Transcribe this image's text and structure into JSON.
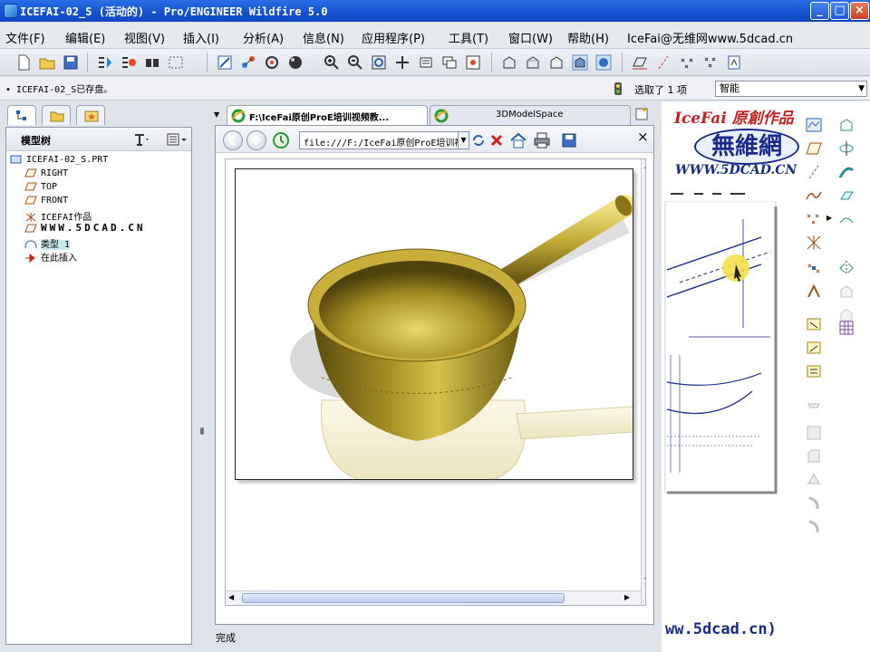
{
  "window": {
    "title": "ICEFAI-02_S (活动的) - Pro/ENGINEER Wildfire 5.0",
    "controls": [
      "_",
      "□",
      "×"
    ]
  },
  "menu": [
    "文件(F)",
    "编辑(E)",
    "视图(V)",
    "插入(I)",
    "分析(A)",
    "信息(N)",
    "应用程序(P)",
    "工具(T)",
    "窗口(W)",
    "帮助(H)"
  ],
  "menu_extra": "IceFai@无维网www.5dcad.cn",
  "message": "• ICEFAI-02_S已存盘。",
  "selection": {
    "status": "选取了 1 项",
    "filter": "智能"
  },
  "navigator": {
    "title": "模型树",
    "items": [
      {
        "label": "ICEFAI-02_S.PRT",
        "icon": "part-icon"
      },
      {
        "label": "RIGHT",
        "icon": "datum-plane-icon"
      },
      {
        "label": "TOP",
        "icon": "datum-plane-icon"
      },
      {
        "label": "FRONT",
        "icon": "datum-plane-icon"
      },
      {
        "label": "ICEFAI作品",
        "icon": "csys-icon"
      },
      {
        "label": "WWW.5DCAD.CN",
        "icon": "annotation-icon"
      },
      {
        "label": "类型 1",
        "icon": "style-icon"
      },
      {
        "label": "在此插入",
        "icon": "insert-here-icon"
      }
    ]
  },
  "browser": {
    "tabs": [
      {
        "label": "F:\\IceFai原创ProE培训视频教..."
      },
      {
        "label": "3DModelSpace"
      }
    ],
    "address": "file:///F:/IceFai原创ProE培训视",
    "status": "完成"
  },
  "graphics_watermark": {
    "line1": "IceFai 原創作品",
    "line2": "無維網",
    "line3": "WWW.5DCAD.CN",
    "url": "ww.5dcad.cn)"
  },
  "colors": {
    "titlebar": "#1553d2",
    "accent_gold": "#b59a2a",
    "close": "#c9421f"
  }
}
